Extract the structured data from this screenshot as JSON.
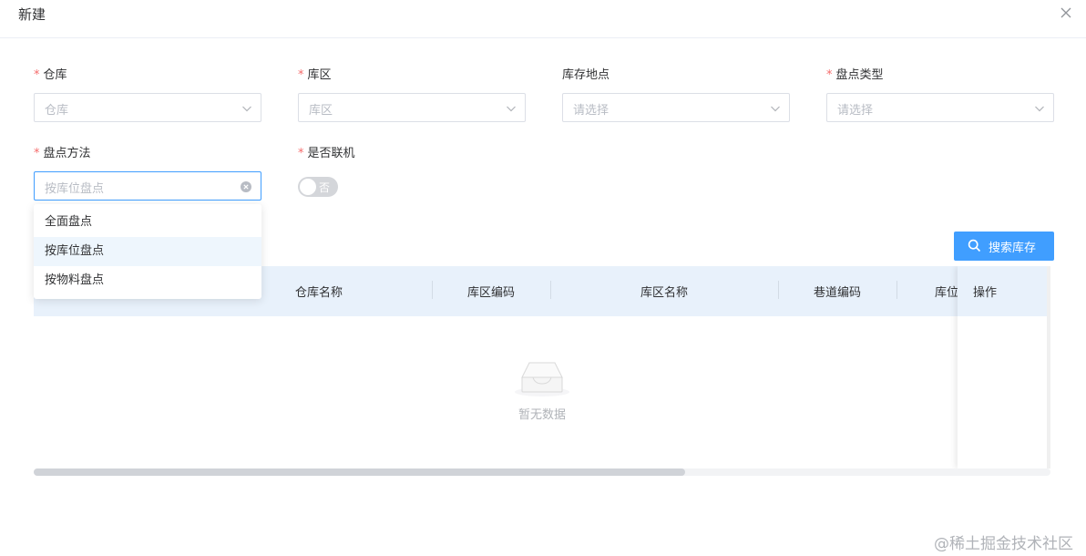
{
  "dialog": {
    "title": "新建",
    "close_icon": "close-icon"
  },
  "form": {
    "warehouse": {
      "label": "仓库",
      "required": true,
      "placeholder": "仓库"
    },
    "zone": {
      "label": "库区",
      "required": true,
      "placeholder": "库区"
    },
    "location": {
      "label": "库存地点",
      "required": false,
      "placeholder": "请选择"
    },
    "inventory_type": {
      "label": "盘点类型",
      "required": true,
      "placeholder": "请选择"
    },
    "method": {
      "label": "盘点方法",
      "required": true,
      "placeholder": "按库位盘点",
      "options": [
        "全面盘点",
        "按库位盘点",
        "按物料盘点"
      ],
      "selected_index": 1
    },
    "online": {
      "label": "是否联机",
      "required": true,
      "value_label": "否",
      "value": false
    }
  },
  "actions": {
    "search_label": "搜索库存",
    "search_icon": "search-icon"
  },
  "table": {
    "columns": [
      "仓库名称",
      "库区编码",
      "库区名称",
      "巷道编码",
      "库位"
    ],
    "fixed_column": "操作",
    "empty_text": "暂无数据",
    "empty_icon": "inbox-icon"
  },
  "watermark": "@稀土掘金技术社区",
  "colors": {
    "primary": "#409eff",
    "required": "#f56c6c",
    "header_bg": "#e8f1fb",
    "option_hover": "#eef6fd"
  }
}
